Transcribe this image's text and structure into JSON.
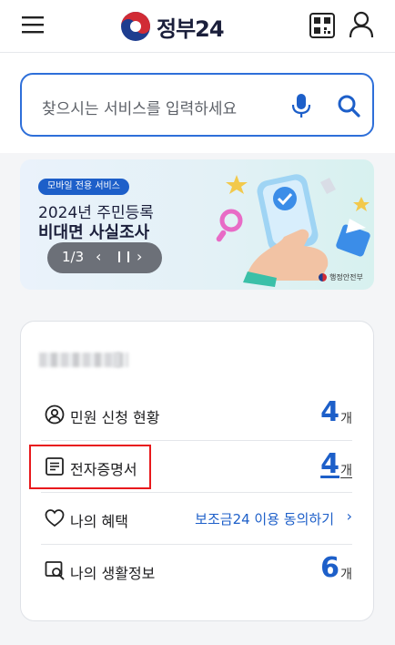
{
  "header": {
    "logo_text": "정부24",
    "icons": [
      "hamburger-menu-icon",
      "qr-code-icon",
      "user-icon"
    ]
  },
  "search": {
    "placeholder": "찾으시는 서비스를 입력하세요",
    "icons": [
      "microphone-icon",
      "search-icon"
    ]
  },
  "banner": {
    "badge": "모바일 전용 서비스",
    "line1": "2024년 주민등록",
    "line2": "비대면 사실조사",
    "pager": {
      "count": "1/3",
      "prev": "‹",
      "pause": "❙❙",
      "next": "›"
    },
    "ministry": "행정안전부"
  },
  "summary": {
    "rows": [
      {
        "icon": "person-circle-icon",
        "label": "민원 신청 현황",
        "count": "4",
        "unit": "개"
      },
      {
        "icon": "document-icon",
        "label": "전자증명서",
        "count": "4",
        "unit": "개"
      },
      {
        "icon": "heart-icon",
        "label": "나의 혜택",
        "link": "보조금24 이용 동의하기",
        "chevron": "›"
      },
      {
        "icon": "window-search-icon",
        "label": "나의 생활정보",
        "count": "6",
        "unit": "개"
      }
    ]
  },
  "colors": {
    "accent": "#1d5fc9",
    "highlight": "#e8191c"
  }
}
